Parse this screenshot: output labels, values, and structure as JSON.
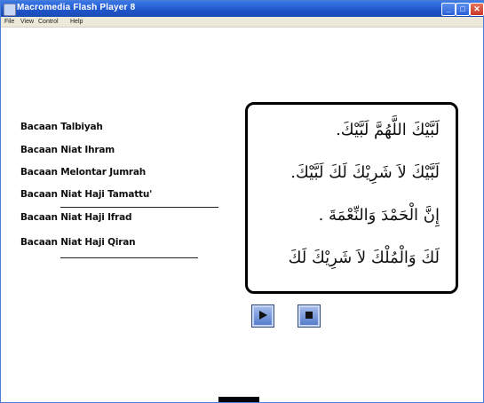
{
  "window": {
    "title": "Macromedia Flash Player 8"
  },
  "menubar": {
    "items": [
      "File",
      "View",
      "Control",
      "Help"
    ]
  },
  "menu": {
    "items": [
      "Bacaan Talbiyah",
      "Bacaan Niat Ihram",
      "Bacaan Melontar Jumrah",
      "Bacaan Niat Haji Tamattu'",
      "Bacaan Niat Haji Ifrad",
      "Bacaan Niat Haji Qiran"
    ]
  },
  "arabic": {
    "lines": [
      "لَبَّيْكَ اللَّهُمَّ لَبَّيْكَ.",
      "لَبَّيْكَ لاَ شَرِيْكَ لَكَ لَبَّيْكَ.",
      "إِنَّ الْحَمْدَ وَالنِّعْمَةَ .",
      "لَكَ وَالْمُلْكَ لاَ شَرِيْكَ لَكَ"
    ]
  },
  "controls": {
    "play_icon": "play-icon",
    "stop_icon": "stop-icon"
  }
}
